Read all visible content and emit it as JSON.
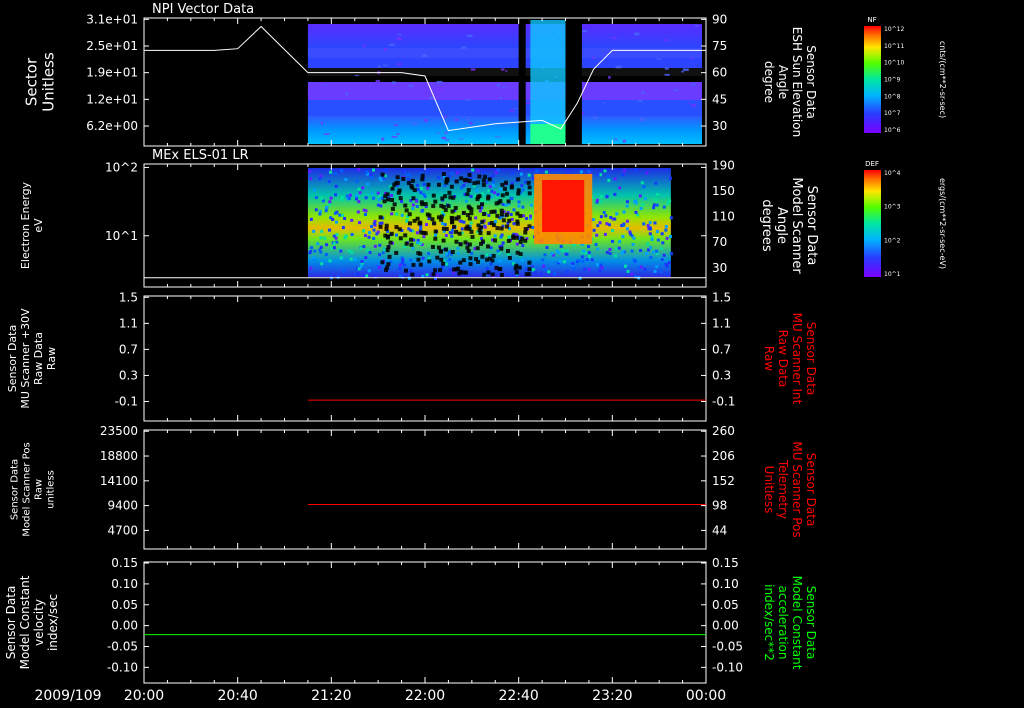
{
  "date_label": "2009/109",
  "time_ticks": [
    "20:00",
    "20:40",
    "21:20",
    "22:00",
    "22:40",
    "23:20",
    "00:00"
  ],
  "colors": {
    "white": "#ffffff",
    "red": "#ff0000",
    "green": "#00ff00",
    "background": "#000000"
  },
  "panels": [
    {
      "id": "npi",
      "title": "NPI Vector Data",
      "left_label": [
        "Sector",
        "Unitless"
      ],
      "left_ticks": [
        "3.1e+01",
        "2.5e+01",
        "1.9e+01",
        "1.2e+01",
        "6.2e+00"
      ],
      "right_label": [
        "Sensor Data",
        "ESH Sun Elevation",
        "Angle",
        "degree"
      ],
      "right_label_color": "#ffffff",
      "right_ticks": [
        "90",
        "75",
        "60",
        "45",
        "30"
      ],
      "colorbar": {
        "label": "NF",
        "units": "cnts/(cm**2-sr-sec)",
        "ticks": [
          "10^12",
          "10^11",
          "10^10",
          "10^9",
          "10^8",
          "10^7",
          "10^6"
        ]
      }
    },
    {
      "id": "els",
      "title": "MEx ELS-01 LR",
      "left_label": [
        "Electron Energy",
        "eV"
      ],
      "left_ticks": [
        "10^2",
        "10^1"
      ],
      "right_label": [
        "Sensor Data",
        "Model Scanner",
        "Angle",
        "degrees"
      ],
      "right_label_color": "#ffffff",
      "right_ticks": [
        "190",
        "150",
        "110",
        "70",
        "30"
      ],
      "colorbar": {
        "label": "DEF",
        "units": "ergs/(cm**2-sr-sec-eV)",
        "ticks": [
          "10^4",
          "10^3",
          "10^2",
          "10^1"
        ]
      }
    },
    {
      "id": "mu_raw",
      "left_label": [
        "Sensor Data",
        "MU Scanner +30V",
        "Raw Data",
        "Raw"
      ],
      "left_ticks": [
        "1.5",
        "1.1",
        "0.7",
        "0.3",
        "-0.1"
      ],
      "right_label": [
        "Sensor Data",
        "MU Scanner Int",
        "Raw Data",
        "Raw"
      ],
      "right_label_color": "#ff0000",
      "right_ticks": [
        "1.5",
        "1.1",
        "0.7",
        "0.3",
        "-0.1"
      ]
    },
    {
      "id": "mu_pos",
      "left_label": [
        "Sensor Data",
        "Model Scanner Pos",
        "Raw",
        "unitless"
      ],
      "left_ticks": [
        "23500",
        "18800",
        "14100",
        "9400",
        "4700"
      ],
      "right_label": [
        "Sensor Data",
        "MU Scanner Pos",
        "Telemetry",
        "Unitless"
      ],
      "right_label_color": "#ff0000",
      "right_ticks": [
        "260",
        "206",
        "152",
        "98",
        "44"
      ]
    },
    {
      "id": "model_const",
      "left_label": [
        "Sensor Data",
        "Model Constant",
        "velocity",
        "index/sec"
      ],
      "left_ticks": [
        "0.15",
        "0.10",
        "0.05",
        "0.00",
        "-0.05",
        "-0.10"
      ],
      "right_label": [
        "Sensor Data",
        "Model Constant",
        "acceleration",
        "index/sec**2"
      ],
      "right_label_color": "#00ff00",
      "right_ticks": [
        "0.15",
        "0.10",
        "0.05",
        "0.00",
        "-0.05",
        "-0.10"
      ]
    }
  ],
  "chart_data": [
    {
      "type": "heatmap",
      "title": "NPI Vector Data",
      "ylabel": "Sector Unitless",
      "x": [
        "20:00",
        "00:00"
      ],
      "data_start": "21:10",
      "gaps": [
        [
          "22:40",
          "22:43"
        ],
        [
          "23:00",
          "23:07"
        ]
      ],
      "overlay_line": {
        "name": "Sensor Data ESH Sun Elevation Angle",
        "units": "degree",
        "x": [
          "20:00",
          "20:30",
          "20:40",
          "20:50",
          "21:10",
          "21:20",
          "21:30",
          "21:40",
          "21:50",
          "22:00",
          "22:10",
          "22:30",
          "22:50",
          "22:58",
          "23:05",
          "23:12",
          "23:20",
          "23:40",
          "00:00"
        ],
        "y": [
          71,
          71,
          72,
          85,
          58,
          58,
          58,
          58,
          58,
          56,
          24,
          28,
          30,
          25,
          40,
          60,
          71,
          71,
          71
        ]
      }
    },
    {
      "type": "heatmap",
      "title": "MEx ELS-01 LR",
      "ylabel": "Electron Energy eV",
      "x": [
        "20:00",
        "00:00"
      ],
      "data_range": [
        "21:10",
        "23:45"
      ],
      "peak_interval": [
        "22:50",
        "23:08"
      ],
      "overlay_line": {
        "name": "Sensor Data Model Scanner Angle",
        "units": "degrees",
        "x": [
          "20:00",
          "00:00"
        ],
        "y": [
          5,
          5
        ]
      }
    },
    {
      "type": "line",
      "ylabel": "Sensor Data MU Scanner +30V Raw Data Raw",
      "ylim": [
        -0.3,
        1.5
      ],
      "x": [
        "21:10",
        "00:00"
      ],
      "y": [
        0.0,
        0.0
      ]
    },
    {
      "type": "line",
      "ylabel": "Sensor Data Model Scanner Pos Raw unitless",
      "ylim": [
        0,
        23500
      ],
      "x": [
        "21:10",
        "00:00"
      ],
      "y": [
        8800,
        8800
      ]
    },
    {
      "type": "line",
      "ylabel": "Sensor Data Model Constant velocity index/sec",
      "ylim": [
        -0.1,
        0.15
      ],
      "x": [
        "20:00",
        "00:00"
      ],
      "y": [
        0.0,
        0.0
      ]
    }
  ]
}
